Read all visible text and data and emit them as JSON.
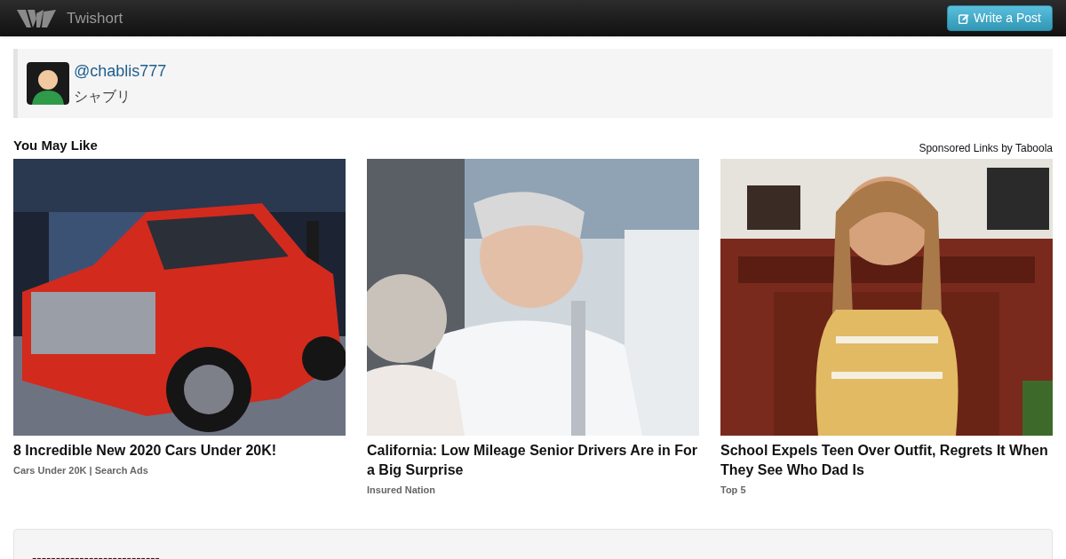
{
  "navbar": {
    "brand": "Twishort",
    "button": "Write a Post"
  },
  "profile": {
    "handle": "@chablis777",
    "name": "シャブリ"
  },
  "recommendations": {
    "title": "You May Like",
    "sponsor": "Sponsored Links by Taboola",
    "items": [
      {
        "title": "8 Incredible New 2020 Cars Under 20K!",
        "source": "Cars Under 20K | Search Ads"
      },
      {
        "title": "California: Low Mileage Senior Drivers Are in For a Big Surprise",
        "source": "Insured Nation"
      },
      {
        "kind": "room",
        "title": "School Expels Teen Over Outfit, Regrets It When They See Who Dad Is",
        "source": "Top 5"
      }
    ]
  },
  "post": {
    "text": "---------------------------"
  }
}
